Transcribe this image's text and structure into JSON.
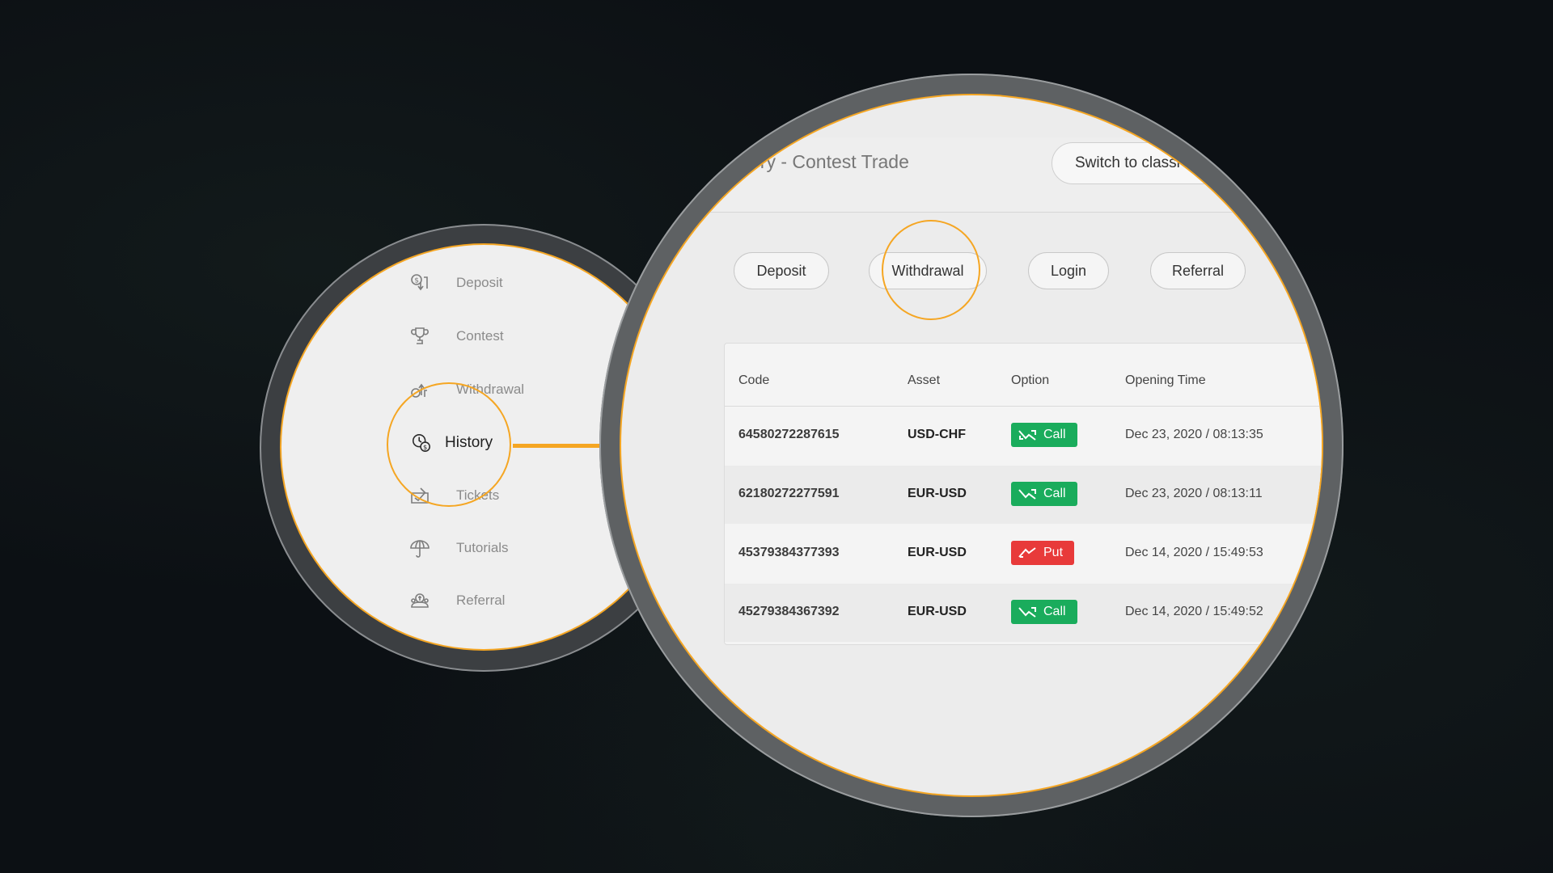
{
  "sidebar": {
    "items": [
      {
        "label": "Deposit",
        "icon": "deposit-icon",
        "active": false
      },
      {
        "label": "Contest",
        "icon": "trophy-icon",
        "active": false
      },
      {
        "label": "Withdrawal",
        "icon": "withdrawal-icon",
        "active": false
      },
      {
        "label": "History",
        "icon": "history-icon",
        "active": true
      },
      {
        "label": "Tickets",
        "icon": "ticket-icon",
        "active": false
      },
      {
        "label": "Tutorials",
        "icon": "umbrella-icon",
        "active": false
      },
      {
        "label": "Referral",
        "icon": "referral-icon",
        "active": false
      }
    ]
  },
  "header": {
    "title": "ory - Contest Trade",
    "switch_label": "Switch to classi"
  },
  "filters": [
    {
      "label": "Deposit"
    },
    {
      "label": "Withdrawal",
      "highlighted": true
    },
    {
      "label": "Login"
    },
    {
      "label": "Referral"
    }
  ],
  "table": {
    "columns": [
      "Code",
      "Asset",
      "Option",
      "Opening Time"
    ],
    "rows": [
      {
        "code": "64580272287615",
        "asset": "USD-CHF",
        "option": "Call",
        "time": "Dec 23, 2020 / 08:13:35"
      },
      {
        "code": "62180272277591",
        "asset": "EUR-USD",
        "option": "Call",
        "time": "Dec 23, 2020 / 08:13:11"
      },
      {
        "code": "45379384377393",
        "asset": "EUR-USD",
        "option": "Put",
        "time": "Dec 14, 2020 / 15:49:53"
      },
      {
        "code": "45279384367392",
        "asset": "EUR-USD",
        "option": "Call",
        "time": "Dec 14, 2020 / 15:49:52"
      }
    ]
  },
  "colors": {
    "accent": "#f5a623",
    "call": "#1aac5c",
    "put": "#e83a3a"
  }
}
